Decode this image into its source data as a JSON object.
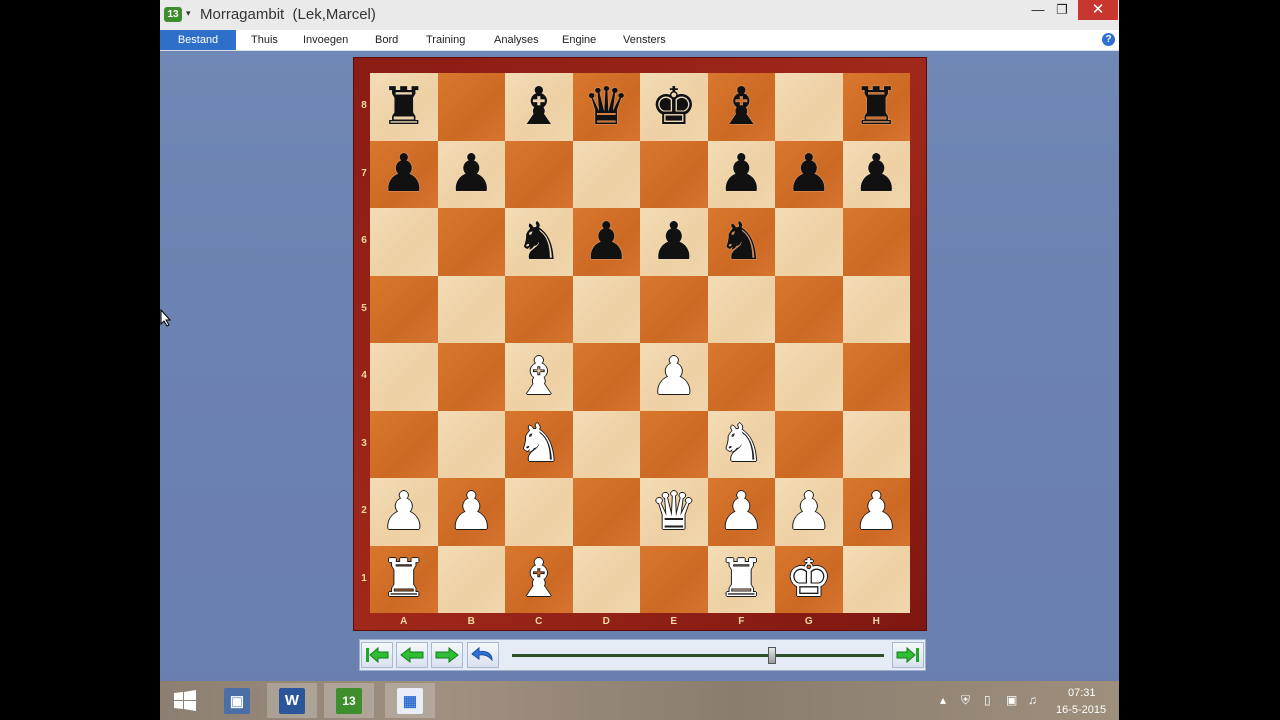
{
  "window": {
    "title": "Morragambit  (Lek,Marcel)",
    "app_icon": "13",
    "min_icon": "—",
    "restore_icon": "❐",
    "close_icon": "✕"
  },
  "menu": {
    "items": [
      "Bestand",
      "Thuis",
      "Invoegen",
      "Bord",
      "Training",
      "Analyses",
      "Engine",
      "Vensters"
    ],
    "active": "Bestand",
    "help_icon": "?"
  },
  "board": {
    "ranks": [
      "8",
      "7",
      "6",
      "5",
      "4",
      "3",
      "2",
      "1"
    ],
    "files": [
      "A",
      "B",
      "C",
      "D",
      "E",
      "F",
      "G",
      "H"
    ],
    "position": [
      [
        "r",
        "",
        "b",
        "q",
        "k",
        "b",
        "",
        "r"
      ],
      [
        "p",
        "p",
        "",
        "",
        "",
        "p",
        "p",
        "p"
      ],
      [
        "",
        "",
        "n",
        "p",
        "p",
        "n",
        "",
        ""
      ],
      [
        "",
        "",
        "",
        "",
        "",
        "",
        "",
        ""
      ],
      [
        "",
        "",
        "B",
        "",
        "P",
        "",
        "",
        ""
      ],
      [
        "",
        "",
        "N",
        "",
        "",
        "N",
        "",
        ""
      ],
      [
        "P",
        "P",
        "",
        "",
        "Q",
        "P",
        "P",
        "P"
      ],
      [
        "R",
        "",
        "B",
        "",
        "",
        "R",
        "K",
        ""
      ]
    ],
    "colors": {
      "light": "#f0d6aa",
      "dark": "#d2702a",
      "frame": "#8a1c14"
    }
  },
  "navigation": {
    "buttons": [
      "first-move",
      "previous-move",
      "next-move",
      "take-back",
      "last-move"
    ],
    "slider_position": 0.7
  },
  "taskbar": {
    "apps": [
      "windows-start",
      "remote-desktop",
      "word",
      "chessbase-13",
      "paint"
    ],
    "word_label": "W",
    "chessbase_label": "13",
    "clock_time": "07:31",
    "clock_date": "16-5-2015",
    "tray_icons": [
      "▴",
      "⛨",
      "▯",
      "▣",
      "♫"
    ]
  }
}
